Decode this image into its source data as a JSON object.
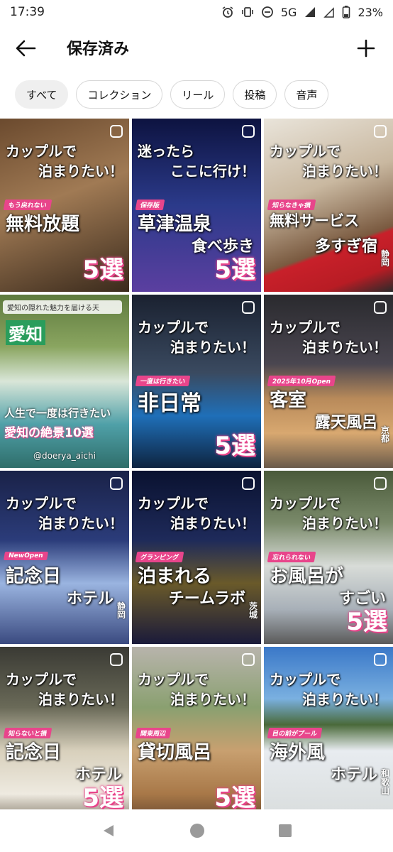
{
  "status": {
    "time": "17:39",
    "network": "5G",
    "battery": "23%"
  },
  "header": {
    "title": "保存済み"
  },
  "filters": [
    "すべて",
    "コレクション",
    "リール",
    "投稿",
    "音声"
  ],
  "tiles": [
    {
      "t1": "カップルで",
      "t2": "泊まりたい！",
      "tag": "もう戻れない",
      "main": "無料放題",
      "sub": "",
      "sel": "5選",
      "pref": ""
    },
    {
      "t1": "迷ったら",
      "t2": "ここに行け！",
      "tag": "保存版",
      "main": "草津温泉",
      "sub": "食べ歩き",
      "sel": "5選",
      "pref": ""
    },
    {
      "t1": "カップルで",
      "t2": "泊まりたい！",
      "tag": "知らなきゃ損",
      "main": "無料サービス",
      "sub": "多すぎ宿",
      "sel": "",
      "pref": "静岡"
    },
    {
      "banner": "愛知の隠れた魅力を届ける天",
      "kanji": "愛知",
      "mid": "人生で一度は行きたい",
      "pink": "愛知の絶景10選",
      "handle": "@doerya_aichi"
    },
    {
      "t1": "カップルで",
      "t2": "泊まりたい！",
      "tag": "一度は行きたい",
      "main": "非日常",
      "sub": "",
      "sel": "5選",
      "pref": ""
    },
    {
      "t1": "カップルで",
      "t2": "泊まりたい！",
      "tag": "2025年10月Open",
      "main": "客室",
      "sub": "露天風呂",
      "sel": "",
      "pref": "京都"
    },
    {
      "t1": "カップルで",
      "t2": "泊まりたい！",
      "tag": "NewOpen",
      "main": "記念日",
      "sub": "ホテル",
      "sel": "",
      "pref": "静岡"
    },
    {
      "t1": "カップルで",
      "t2": "泊まりたい！",
      "tag": "グランピング",
      "main": "泊まれる",
      "sub": "チームラボ",
      "sel": "",
      "pref": "茨城"
    },
    {
      "t1": "カップルで",
      "t2": "泊まりたい！",
      "tag": "忘れられない",
      "main": "お風呂が",
      "sub": "すごい",
      "sel": "5選",
      "pref": ""
    },
    {
      "t1": "カップルで",
      "t2": "泊まりたい！",
      "tag": "知らないと損",
      "main": "記念日",
      "sub": "ホテル",
      "sel": "5選",
      "pref": ""
    },
    {
      "t1": "カップルで",
      "t2": "泊まりたい！",
      "tag": "関東周辺",
      "main": "貸切風呂",
      "sub": "",
      "sel": "5選",
      "pref": ""
    },
    {
      "t1": "カップルで",
      "t2": "泊まりたい！",
      "tag": "目の前がプール",
      "main": "海外風",
      "sub": "ホテル",
      "sel": "",
      "pref": "和歌山"
    }
  ]
}
